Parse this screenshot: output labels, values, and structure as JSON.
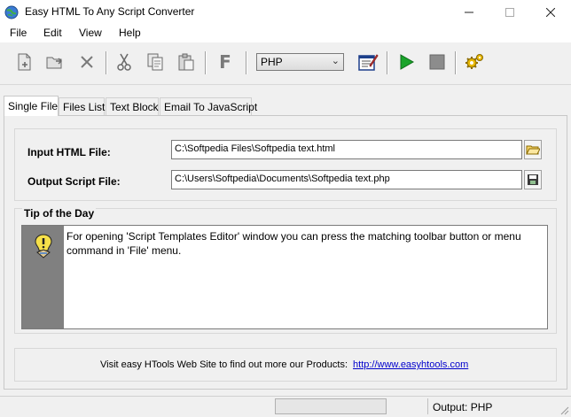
{
  "window": {
    "title": "Easy HTML To Any Script Converter",
    "min_icon": "minimize-icon",
    "max_icon": "maximize-icon",
    "close_icon": "close-icon"
  },
  "menu": [
    "File",
    "Edit",
    "View",
    "Help"
  ],
  "toolbar": {
    "language_select": "PHP",
    "buttons": [
      "new-file-icon",
      "open-file-icon",
      "delete-icon",
      "cut-icon",
      "copy-icon",
      "paste-icon",
      "format-icon",
      "script-templates-editor-icon",
      "run-icon",
      "stop-icon",
      "settings-icon"
    ],
    "format_glyph": "F",
    "colors": {
      "run": "#1aa32a",
      "stop": "#8c8c8c",
      "settings": "#c8a000"
    }
  },
  "tabs": [
    "Single File",
    "Files List",
    "Text Block",
    "Email To JavaScript"
  ],
  "active_tab": 0,
  "form": {
    "input_label": "Input HTML File:",
    "input_value": "C:\\Softpedia Files\\Softpedia text.html",
    "output_label": "Output Script File:",
    "output_value": "C:\\Users\\Softpedia\\Documents\\Softpedia text.php"
  },
  "tip": {
    "title": "Tip of the Day",
    "text": "For opening 'Script Templates Editor' window you can press the matching toolbar button or menu command in 'File' menu."
  },
  "footer": {
    "text": "Visit easy HTools Web Site to find out more our Products:",
    "link": "http://www.easyhtools.com"
  },
  "status": {
    "output": "Output: PHP"
  }
}
